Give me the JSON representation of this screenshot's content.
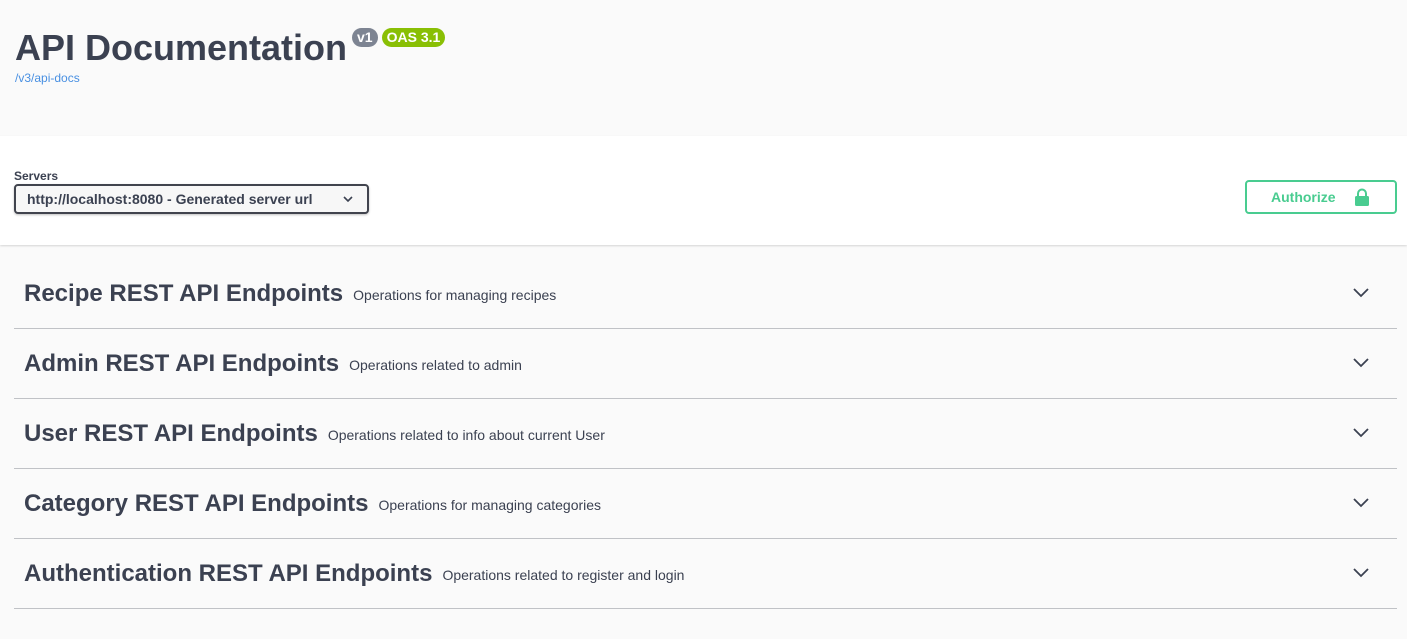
{
  "info": {
    "title": "API Documentation",
    "version_badge": "v1",
    "oas_badge": "OAS 3.1",
    "spec_link": "/v3/api-docs"
  },
  "servers": {
    "label": "Servers",
    "selected": "http://localhost:8080 - Generated server url"
  },
  "authorize": {
    "label": "Authorize"
  },
  "colors": {
    "accent_green": "#49cc90",
    "oas_badge": "#89bf04",
    "version_badge": "#7d8492",
    "link": "#4990e2"
  },
  "tags": [
    {
      "name": "Recipe REST API Endpoints",
      "description": "Operations for managing recipes"
    },
    {
      "name": "Admin REST API Endpoints",
      "description": "Operations related to admin"
    },
    {
      "name": "User REST API Endpoints",
      "description": "Operations related to info about current User"
    },
    {
      "name": "Category REST API Endpoints",
      "description": "Operations for managing categories"
    },
    {
      "name": "Authentication REST API Endpoints",
      "description": "Operations related to register and login"
    }
  ]
}
